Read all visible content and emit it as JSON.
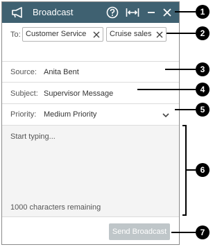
{
  "header": {
    "title": "Broadcast",
    "icons": [
      "megaphone-icon",
      "help-icon",
      "expand-width-icon",
      "minimize-icon",
      "close-icon"
    ],
    "background": "#3f6171"
  },
  "to": {
    "label": "To:",
    "recipients": [
      "Customer Service",
      "Cruise sales"
    ]
  },
  "source": {
    "label": "Source:",
    "value": "Anita Bent"
  },
  "subject": {
    "label": "Subject:",
    "value": "Supervisor Message"
  },
  "priority": {
    "label": "Priority:",
    "value": "Medium Priority"
  },
  "message": {
    "placeholder": "Start typing...",
    "remaining": "1000 characters remaining"
  },
  "send_button": {
    "label": "Send Broadcast",
    "color": "#bfc6c9"
  },
  "callouts": [
    "1",
    "2",
    "3",
    "4",
    "5",
    "6",
    "7"
  ]
}
